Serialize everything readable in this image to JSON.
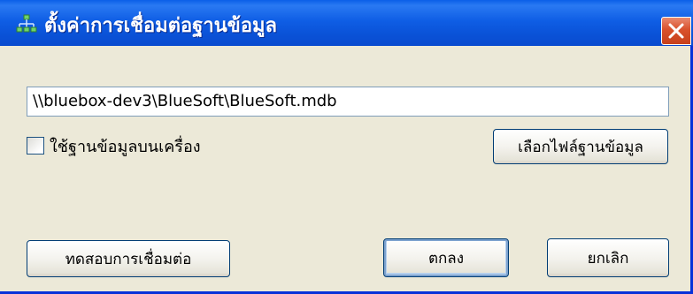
{
  "window": {
    "title": "ตั้งค่าการเชื่อมต่อฐานข้อมูล",
    "title_icon": "network-tree-icon",
    "close_icon": "close-icon"
  },
  "form": {
    "db_path_value": "\\\\bluebox-dev3\\BlueSoft\\BlueSoft.mdb",
    "use_local_db_label": "ใช้ฐานข้อมูลบนเครื่อง",
    "use_local_db_checked": false,
    "pick_db_file_label": "เลือกไฟล์ฐานข้อมูล"
  },
  "footer": {
    "test_connection_label": "ทดสอบการเชื่อมต่อ",
    "ok_label": "ตกลง",
    "cancel_label": "ยกเลิก"
  },
  "colors": {
    "titlebar": "#0a5fe8",
    "dialog_bg": "#ece9d8",
    "close_button": "#d9512c"
  }
}
